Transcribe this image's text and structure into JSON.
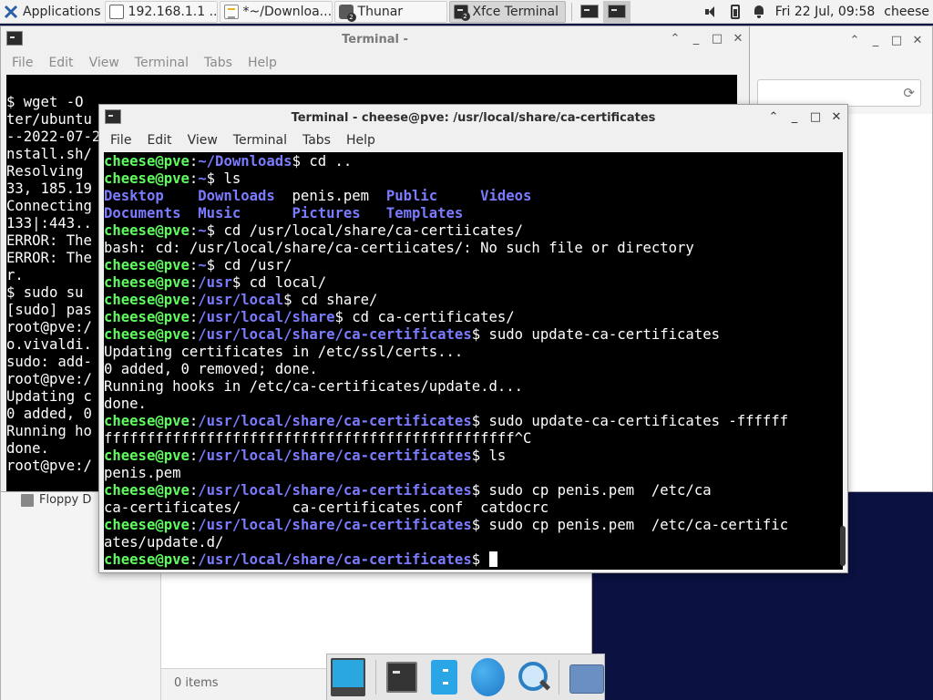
{
  "panel": {
    "applications_label": "Applications",
    "tasks": [
      {
        "label": "192.168.1.1 ...",
        "icon": "web-browser-icon"
      },
      {
        "label": "*~/Downloa...",
        "icon": "text-editor-icon"
      },
      {
        "label": "Thunar",
        "icon": "folder-icon",
        "badge": "2"
      },
      {
        "label": "Xfce Terminal",
        "icon": "terminal-icon",
        "badge": "2"
      }
    ],
    "clock": "Fri 22 Jul, 09:58",
    "user": "cheese"
  },
  "back_terminal": {
    "title": "Terminal -",
    "menu": [
      "File",
      "Edit",
      "View",
      "Terminal",
      "Tabs",
      "Help"
    ],
    "lines": [
      "",
      "$ wget -O",
      "ter/ubuntu",
      "--2022-07-2",
      "nstall.sh/",
      "Resolving",
      "33, 185.19",
      "Connecting",
      "133|:443..",
      "ERROR: The",
      "ERROR: The",
      "r.",
      "$ sudo su",
      "[sudo] pas",
      "root@pve:/",
      "o.vivaldi.",
      "sudo: add-",
      "root@pve:/",
      "Updating c",
      "0 added, 0",
      "Running ho",
      "done.",
      "root@pve:/"
    ]
  },
  "thunar_bg": {
    "side_item": "Floppy D",
    "status": "0 items"
  },
  "front_terminal": {
    "title": "Terminal - cheese@pve: /usr/local/share/ca-certificates",
    "menu": [
      "File",
      "Edit",
      "View",
      "Terminal",
      "Tabs",
      "Help"
    ],
    "lines": [
      {
        "user": "cheese@pve",
        "path": "~/Downloads",
        "cmd": "$ cd .."
      },
      {
        "user": "cheese@pve",
        "path": "~",
        "cmd": "$ ls"
      },
      {
        "dirs": "Desktop    Downloads  ",
        "file": "penis.pem  ",
        "dirs2": "Public     Videos"
      },
      {
        "dirs": "Documents  Music      Pictures   Templates"
      },
      {
        "user": "cheese@pve",
        "path": "~",
        "cmd": "$ cd /usr/local/share/ca-certiicates/"
      },
      {
        "text": "bash: cd: /usr/local/share/ca-certiicates/: No such file or directory"
      },
      {
        "user": "cheese@pve",
        "path": "~",
        "cmd": "$ cd /usr/"
      },
      {
        "user": "cheese@pve",
        "path": "/usr",
        "cmd": "$ cd local/"
      },
      {
        "user": "cheese@pve",
        "path": "/usr/local",
        "cmd": "$ cd share/"
      },
      {
        "user": "cheese@pve",
        "path": "/usr/local/share",
        "cmd": "$ cd ca-certificates/"
      },
      {
        "user": "cheese@pve",
        "path": "/usr/local/share/ca-certificates",
        "cmd": "$ sudo update-ca-certificates"
      },
      {
        "text": "Updating certificates in /etc/ssl/certs..."
      },
      {
        "text": "0 added, 0 removed; done."
      },
      {
        "text": "Running hooks in /etc/ca-certificates/update.d..."
      },
      {
        "text": "done."
      },
      {
        "user": "cheese@pve",
        "path": "/usr/local/share/ca-certificates",
        "cmd": "$ sudo update-ca-certificates -ffffff"
      },
      {
        "text": "ffffffffffffffffffffffffffffffffffffffffffffffff^C"
      },
      {
        "user": "cheese@pve",
        "path": "/usr/local/share/ca-certificates",
        "cmd": "$ ls"
      },
      {
        "text": "penis.pem"
      },
      {
        "user": "cheese@pve",
        "path": "/usr/local/share/ca-certificates",
        "cmd": "$ sudo cp penis.pem  /etc/ca"
      },
      {
        "text": "ca-certificates/      ca-certificates.conf  catdocrc"
      },
      {
        "user": "cheese@pve",
        "path": "/usr/local/share/ca-certificates",
        "cmd": "$ sudo cp penis.pem  /etc/ca-certific"
      },
      {
        "text": "ates/update.d/"
      },
      {
        "user": "cheese@pve",
        "path": "/usr/local/share/ca-certificates",
        "cmd": "$ ",
        "cursor": true
      }
    ]
  },
  "dock": {
    "items": [
      "show-desktop-icon",
      "terminal-icon",
      "file-cabinet-icon",
      "web-browser-icon",
      "app-finder-icon",
      "home-folder-icon"
    ]
  }
}
